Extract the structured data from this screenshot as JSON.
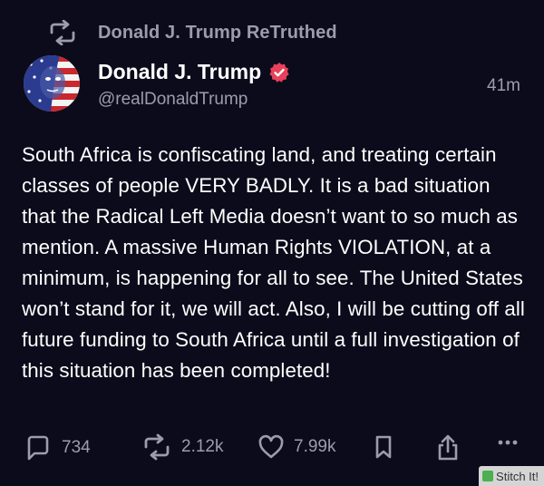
{
  "retruth": {
    "icon": "retruth-icon",
    "label": "Donald J. Trump ReTruthed"
  },
  "author": {
    "avatar": "avatar",
    "display_name": "Donald J. Trump",
    "verified_icon": "verified-badge-icon",
    "handle": "@realDonaldTrump",
    "timestamp": "41m"
  },
  "post": {
    "text": "South Africa is confiscating land, and treating certain classes of people VERY BADLY. It is a bad situation that the Radical Left Media doesn’t want to so much as mention. A massive Human Rights VIOLATION, at a minimum, is happening for all to see. The United States won’t stand for it, we will act. Also, I will be cutting off all future funding to South Africa until a full investigation of this situation has been completed!"
  },
  "actions": {
    "replies": {
      "icon": "reply-icon",
      "count": "734"
    },
    "retruths": {
      "icon": "retruth-icon",
      "count": "2.12k"
    },
    "likes": {
      "icon": "heart-icon",
      "count": "7.99k"
    },
    "bookmark": {
      "icon": "bookmark-icon"
    },
    "share": {
      "icon": "share-icon"
    },
    "more": {
      "icon": "more-icon"
    }
  },
  "watermark": {
    "label": "Stitch It!"
  },
  "colors": {
    "background": "#0c0b1b",
    "muted": "#9e9bae",
    "verified": "#e8415b"
  }
}
